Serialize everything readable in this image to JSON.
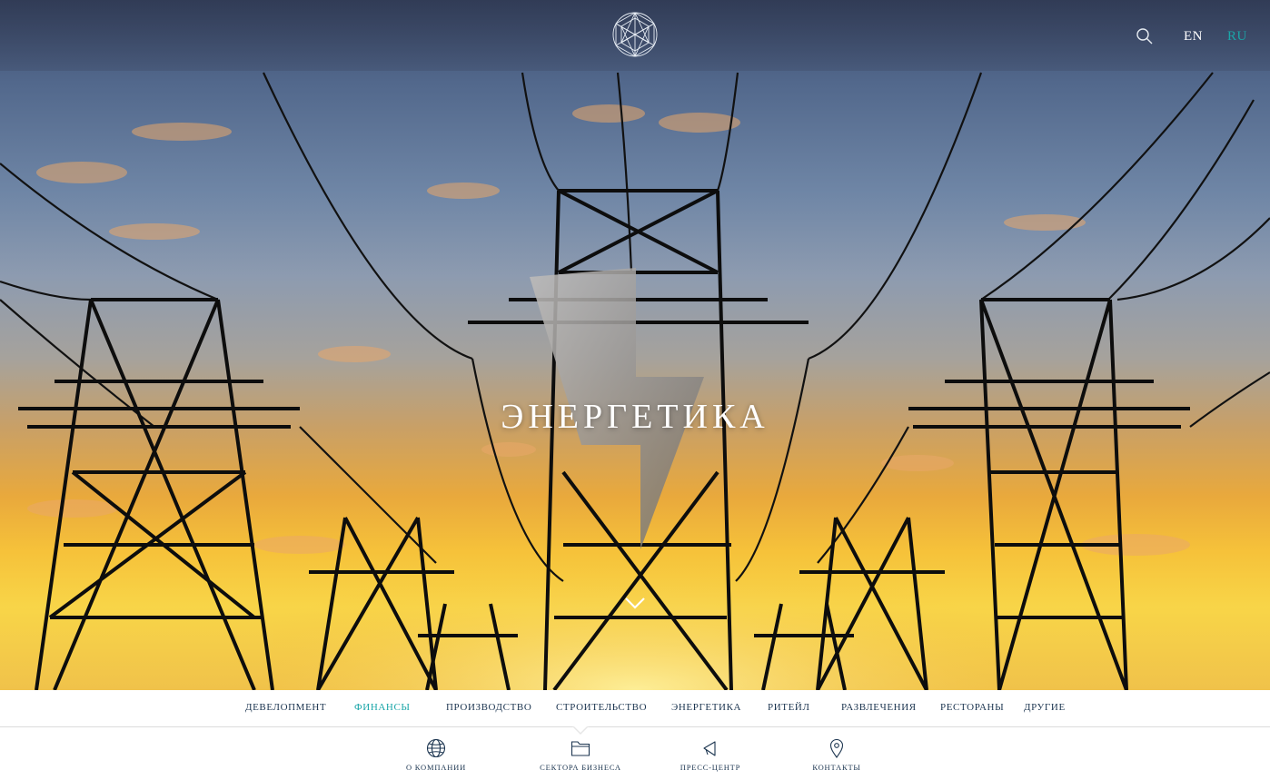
{
  "header": {
    "lang_en": "EN",
    "lang_ru": "RU",
    "active_lang_color": "#1aa6a8"
  },
  "hero": {
    "title": "ЭНЕРГЕТИКА"
  },
  "sectors": [
    {
      "label": "ДЕВЕЛОПМЕНТ",
      "active": false
    },
    {
      "label": "ФИНАНСЫ",
      "active": true
    },
    {
      "label": "ПРОИЗВОДСТВО",
      "active": false
    },
    {
      "label": "СТРОИТЕЛЬСТВО",
      "active": false
    },
    {
      "label": "ЭНЕРГЕТИКА",
      "active": false
    },
    {
      "label": "РИТЕЙЛ",
      "active": false
    },
    {
      "label": "РАЗВЛЕЧЕНИЯ",
      "active": false
    },
    {
      "label": "РЕСТОРАНЫ",
      "active": false
    },
    {
      "label": "ДРУГИЕ",
      "active": false
    }
  ],
  "bottom_nav": [
    {
      "label": "О КОМПАНИИ",
      "icon": "globe-icon"
    },
    {
      "label": "СЕКТОРА БИЗНЕСА",
      "icon": "folder-icon"
    },
    {
      "label": "ПРЕСС-ЦЕНТР",
      "icon": "megaphone-icon"
    },
    {
      "label": "КОНТАКТЫ",
      "icon": "map-pin-icon"
    }
  ],
  "colors": {
    "accent": "#1aa6a8",
    "nav_text": "#1c3550"
  }
}
